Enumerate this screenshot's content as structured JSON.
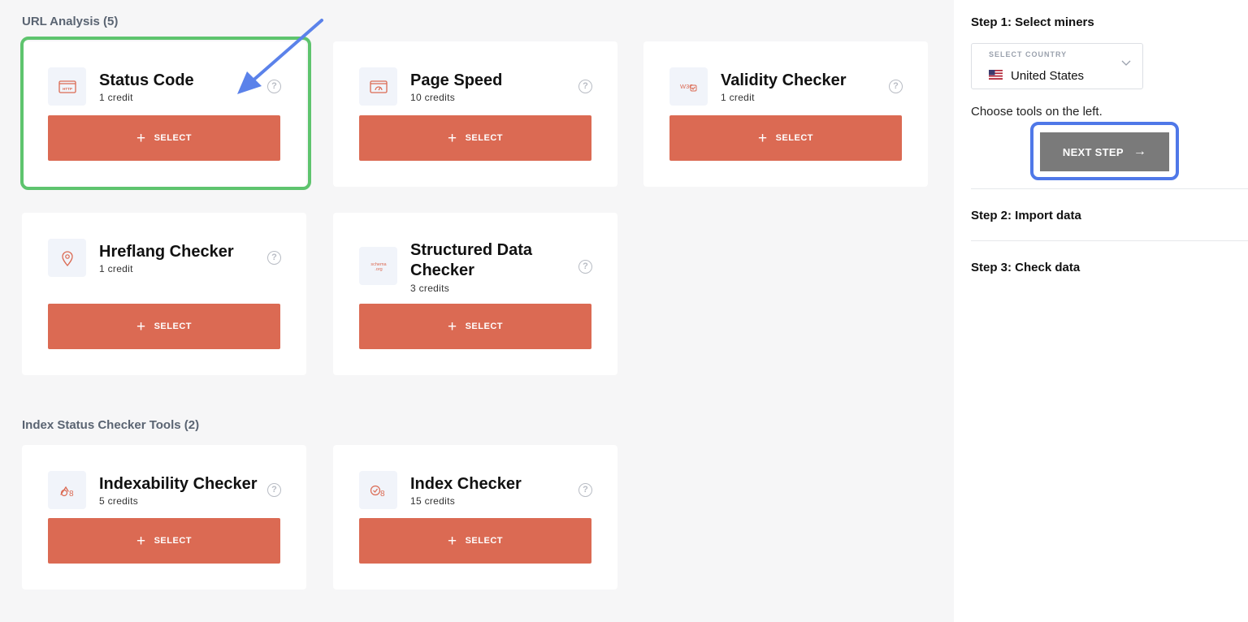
{
  "sections": {
    "url_analysis": "URL Analysis (5)",
    "index_status": "Index Status Checker Tools (2)"
  },
  "cards": {
    "status_code": {
      "name": "Status Code",
      "credits": "1 credit",
      "icon": "http-icon",
      "select_label": "SELECT"
    },
    "page_speed": {
      "name": "Page Speed",
      "credits": "10 credits",
      "icon": "speedometer-window-icon",
      "select_label": "SELECT"
    },
    "validity": {
      "name": "Validity Checker",
      "credits": "1 credit",
      "icon": "w3c-icon",
      "select_label": "SELECT"
    },
    "hreflang": {
      "name": "Hreflang Checker",
      "credits": "1 credit",
      "icon": "map-pin-icon",
      "select_label": "SELECT"
    },
    "structured": {
      "name_line1": "Structured Data",
      "name_line2": "Checker",
      "credits": "3 credits",
      "icon": "schema-org-icon",
      "icon_text_1": "schema",
      "icon_text_2": ".org",
      "select_label": "SELECT"
    },
    "indexability": {
      "name": "Indexability Checker",
      "credits": "5 credits",
      "icon": "indexability-icon",
      "select_label": "SELECT"
    },
    "index_checker": {
      "name": "Index Checker",
      "credits": "15 credits",
      "icon": "index-check-icon",
      "select_label": "SELECT"
    }
  },
  "icons": {
    "help": "?",
    "plus": "+",
    "w3c": "W3C"
  },
  "panel": {
    "step1": "Step 1: Select miners",
    "country_label": "SELECT COUNTRY",
    "country_value": "United States",
    "hint": "Choose tools on the left.",
    "next_label": "NEXT STEP",
    "next_arrow": "→",
    "step2": "Step 2: Import data",
    "step3": "Step 3: Check data"
  },
  "colors": {
    "accent": "#db6a53",
    "highlight_green": "#5ec46e",
    "highlight_blue": "#4f78e8",
    "next_btn": "#7a7a7a"
  }
}
